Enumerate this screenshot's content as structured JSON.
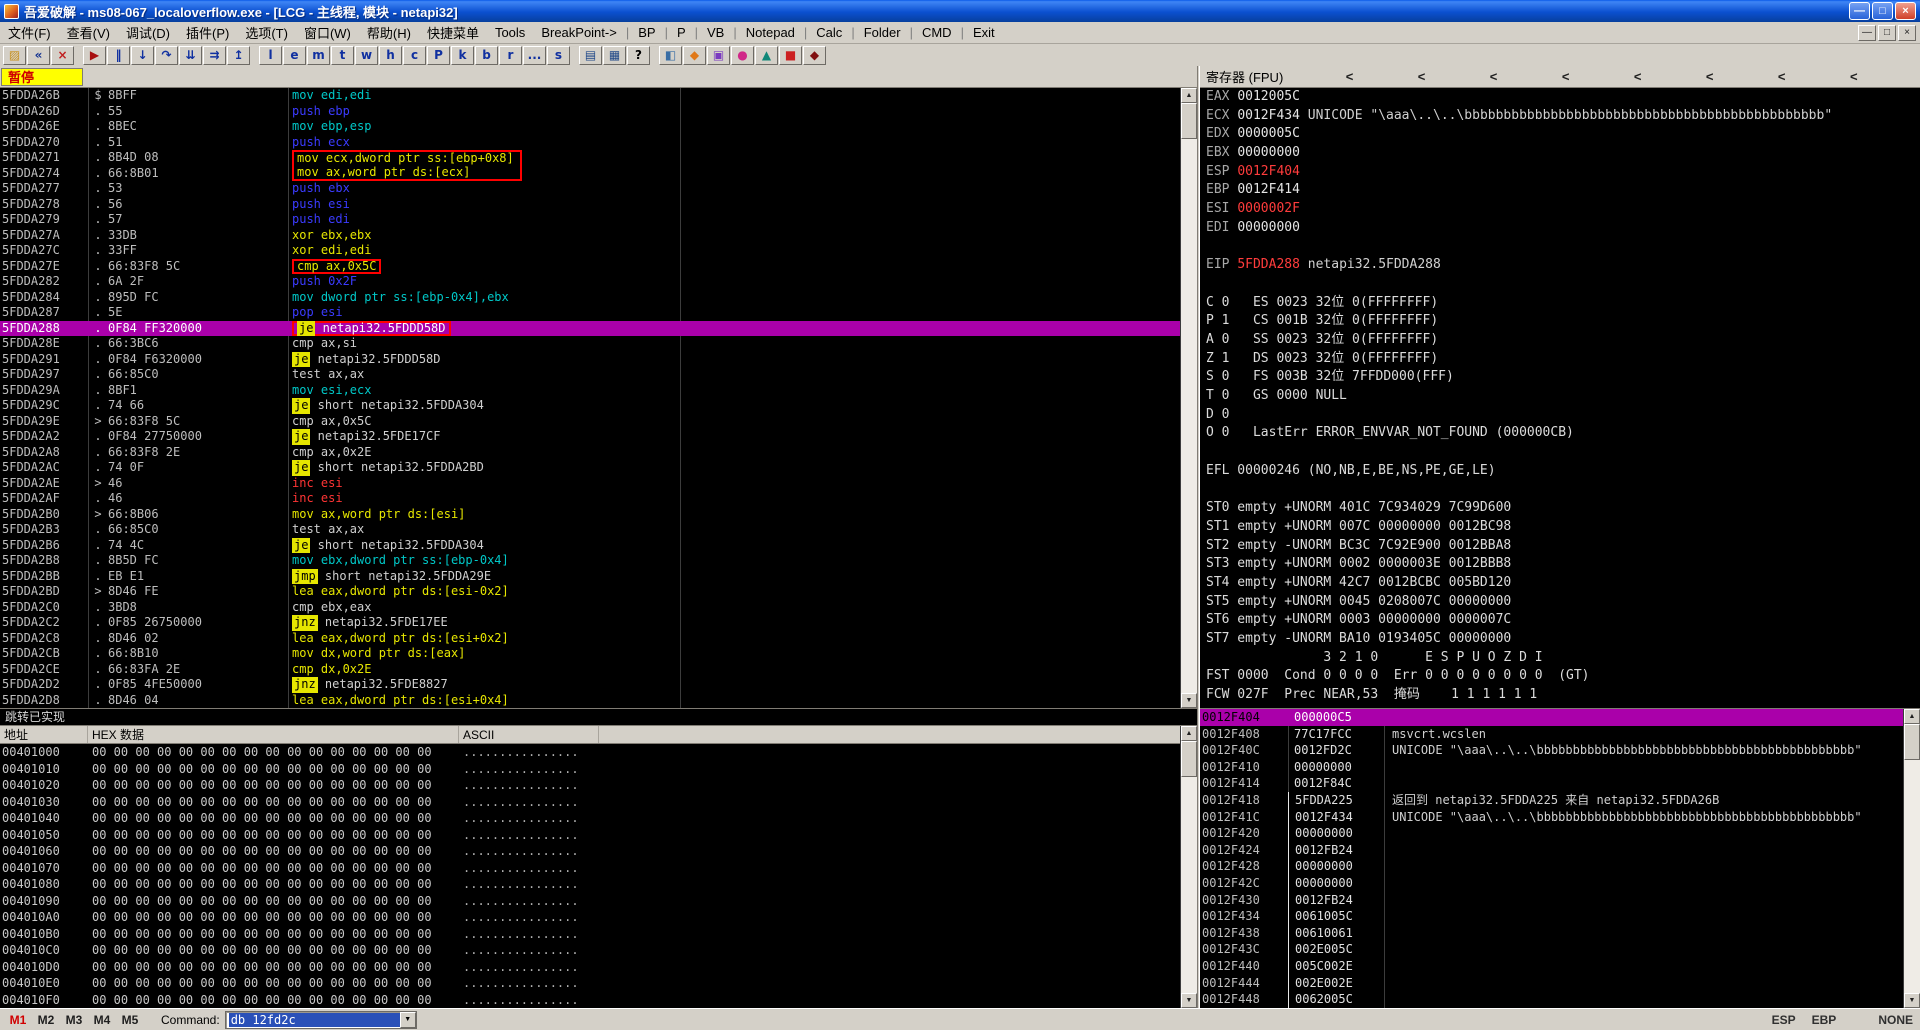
{
  "window": {
    "title": "吾爱破解 - ms08-067_localoverflow.exe - [LCG - 主线程, 模块 - netapi32]",
    "controls": {
      "minimize": "—",
      "maximize": "□",
      "close": "×"
    },
    "mdi": {
      "minimize": "—",
      "restore": "□",
      "close": "×"
    }
  },
  "icons": {
    "scroll_up": "▲",
    "scroll_down": "▼",
    "combo_down": "▼"
  },
  "menu": {
    "items": [
      "文件(F)",
      "查看(V)",
      "调试(D)",
      "插件(P)",
      "选项(T)",
      "窗口(W)",
      "帮助(H)"
    ],
    "extras": [
      "快捷菜单",
      "Tools",
      "BreakPoint->"
    ],
    "quick": [
      "BP",
      "P",
      "VB",
      "Notepad",
      "Calc",
      "Folder",
      "CMD",
      "Exit"
    ]
  },
  "toolbar": {
    "groups": [
      {
        "buttons": [
          {
            "name": "open-file-button",
            "glyph": "▨",
            "color": "#c8901c"
          },
          {
            "name": "restart-button",
            "glyph": "«",
            "color": "#103090"
          },
          {
            "name": "close-process-button",
            "glyph": "×",
            "color": "#c02020"
          }
        ]
      },
      {
        "buttons": [
          {
            "name": "run-button",
            "glyph": "▶",
            "color": "#a81010"
          },
          {
            "name": "pause-button",
            "glyph": "‖",
            "color": "#1030a0"
          },
          {
            "name": "step-into-button",
            "glyph": "↓",
            "color": "#1030a0"
          },
          {
            "name": "step-over-button",
            "glyph": "↷",
            "color": "#1030a0"
          },
          {
            "name": "trace-into-button",
            "glyph": "⇊",
            "color": "#1030a0"
          },
          {
            "name": "trace-over-button",
            "glyph": "⇉",
            "color": "#1030a0"
          },
          {
            "name": "execute-till-return-button",
            "glyph": "↥",
            "color": "#1030a0"
          }
        ]
      },
      {
        "buttons": [
          {
            "name": "log-window-button",
            "glyph": "l",
            "color": "#1030a0"
          },
          {
            "name": "executables-window-button",
            "glyph": "e",
            "color": "#1030a0"
          },
          {
            "name": "memory-map-button",
            "glyph": "m",
            "color": "#1030a0"
          },
          {
            "name": "threads-window-button",
            "glyph": "t",
            "color": "#1030a0"
          },
          {
            "name": "windows-window-button",
            "glyph": "w",
            "color": "#1030a0"
          },
          {
            "name": "handles-window-button",
            "glyph": "h",
            "color": "#1030a0"
          },
          {
            "name": "cpu-window-button",
            "glyph": "c",
            "color": "#1030a0"
          },
          {
            "name": "patches-window-button",
            "glyph": "P",
            "color": "#1030a0"
          },
          {
            "name": "call-stack-button",
            "glyph": "k",
            "color": "#1030a0"
          },
          {
            "name": "breakpoints-window-button",
            "glyph": "b",
            "color": "#1030a0"
          },
          {
            "name": "references-window-button",
            "glyph": "r",
            "color": "#1030a0"
          },
          {
            "name": "run-trace-button",
            "glyph": "...",
            "color": "#1030a0"
          },
          {
            "name": "source-window-button",
            "glyph": "s",
            "color": "#1030a0"
          }
        ]
      },
      {
        "buttons": [
          {
            "name": "log-data-button",
            "glyph": "▤",
            "color": "#204888"
          },
          {
            "name": "modules-list-button",
            "glyph": "▦",
            "color": "#204888"
          },
          {
            "name": "help-button",
            "glyph": "?",
            "color": "#000000"
          }
        ]
      },
      {
        "buttons": [
          {
            "name": "plugin-button-1",
            "glyph": "◧",
            "color": "#3a6ea5"
          },
          {
            "name": "plugin-button-2",
            "glyph": "◆",
            "color": "#e07818"
          },
          {
            "name": "plugin-button-3",
            "glyph": "▣",
            "color": "#7a3ac0"
          },
          {
            "name": "plugin-button-4",
            "glyph": "●",
            "color": "#d02888"
          },
          {
            "name": "plugin-button-5",
            "glyph": "▲",
            "color": "#108878"
          },
          {
            "name": "plugin-button-6",
            "glyph": "■",
            "color": "#cc2020"
          },
          {
            "name": "plugin-button-7",
            "glyph": "◆",
            "color": "#801010"
          }
        ]
      }
    ]
  },
  "state": {
    "label": "暂停"
  },
  "disasm": {
    "rows": [
      {
        "a": "5FDDA26B",
        "m": "$",
        "b": "8BFF",
        "t": "mov edi,edi",
        "c": "cyan"
      },
      {
        "a": "5FDDA26D",
        "m": ".",
        "b": "55",
        "t": "push ebp",
        "c": "blue"
      },
      {
        "a": "5FDDA26E",
        "m": ".",
        "b": "8BEC",
        "t": "mov ebp,esp",
        "c": "cyan"
      },
      {
        "a": "5FDDA270",
        "m": ".",
        "b": "51",
        "t": "push ecx",
        "c": "blue"
      },
      {
        "a": "5FDDA271",
        "m": ".",
        "b": "8B4D 08",
        "t": "mov ecx,dword ptr ss:[ebp+0x8]",
        "c": "yellow",
        "box": "top",
        "fixed": true
      },
      {
        "a": "5FDDA274",
        "m": ".",
        "b": "66:8B01",
        "t": "mov ax,word ptr ds:[ecx]",
        "c": "yellow",
        "box": "bottom",
        "fixed": true
      },
      {
        "a": "5FDDA277",
        "m": ".",
        "b": "53",
        "t": "push ebx",
        "c": "blue"
      },
      {
        "a": "5FDDA278",
        "m": ".",
        "b": "56",
        "t": "push esi",
        "c": "blue"
      },
      {
        "a": "5FDDA279",
        "m": ".",
        "b": "57",
        "t": "push edi",
        "c": "blue"
      },
      {
        "a": "5FDDA27A",
        "m": ".",
        "b": "33DB",
        "t": "xor ebx,ebx",
        "c": "yellow"
      },
      {
        "a": "5FDDA27C",
        "m": ".",
        "b": "33FF",
        "t": "xor edi,edi",
        "c": "yellow"
      },
      {
        "a": "5FDDA27E",
        "m": ".",
        "b": "66:83F8 5C",
        "t": "cmp ax,0x5C",
        "c": "yellow",
        "box": "single"
      },
      {
        "a": "5FDDA282",
        "m": ".",
        "b": "6A 2F",
        "t": "push 0x2F",
        "c": "blue"
      },
      {
        "a": "5FDDA284",
        "m": ".",
        "b": "895D FC",
        "t": "mov dword ptr ss:[ebp-0x4],ebx",
        "c": "cyan"
      },
      {
        "a": "5FDDA287",
        "m": ".",
        "b": "5E",
        "t": "pop esi",
        "c": "blue"
      },
      {
        "a": "5FDDA288",
        "m": ".",
        "b": "0F84 FF320000",
        "badge": "je",
        "rest": "netapi32.5FDDD58D",
        "sel": true,
        "box": "single"
      },
      {
        "a": "5FDDA28E",
        "m": ".",
        "b": "66:3BC6",
        "t": "cmp ax,si",
        "c": "white"
      },
      {
        "a": "5FDDA291",
        "m": ".",
        "b": "0F84 F6320000",
        "badge": "je",
        "rest": "netapi32.5FDDD58D"
      },
      {
        "a": "5FDDA297",
        "m": ".",
        "b": "66:85C0",
        "t": "test ax,ax",
        "c": "white"
      },
      {
        "a": "5FDDA29A",
        "m": ".",
        "b": "8BF1",
        "t": "mov esi,ecx",
        "c": "cyan"
      },
      {
        "a": "5FDDA29C",
        "m": ".",
        "b": "74 66",
        "badge": "je",
        "rest": "short netapi32.5FDDA304"
      },
      {
        "a": "5FDDA29E",
        "m": ">",
        "b": "66:83F8 5C",
        "t": "cmp ax,0x5C",
        "c": "white"
      },
      {
        "a": "5FDDA2A2",
        "m": ".",
        "b": "0F84 27750000",
        "badge": "je",
        "rest": "netapi32.5FDE17CF"
      },
      {
        "a": "5FDDA2A8",
        "m": ".",
        "b": "66:83F8 2E",
        "t": "cmp ax,0x2E",
        "c": "white"
      },
      {
        "a": "5FDDA2AC",
        "m": ".",
        "b": "74 0F",
        "badge": "je",
        "rest": "short netapi32.5FDDA2BD"
      },
      {
        "a": "5FDDA2AE",
        "m": ">",
        "b": "46",
        "t": "inc esi",
        "c": "red"
      },
      {
        "a": "5FDDA2AF",
        "m": ".",
        "b": "46",
        "t": "inc esi",
        "c": "red"
      },
      {
        "a": "5FDDA2B0",
        "m": ">",
        "b": "66:8B06",
        "t": "mov ax,word ptr ds:[esi]",
        "c": "yellow"
      },
      {
        "a": "5FDDA2B3",
        "m": ".",
        "b": "66:85C0",
        "t": "test ax,ax",
        "c": "white"
      },
      {
        "a": "5FDDA2B6",
        "m": ".",
        "b": "74 4C",
        "badge": "je",
        "rest": "short netapi32.5FDDA304"
      },
      {
        "a": "5FDDA2B8",
        "m": ".",
        "b": "8B5D FC",
        "t": "mov ebx,dword ptr ss:[ebp-0x4]",
        "c": "cyan"
      },
      {
        "a": "5FDDA2BB",
        "m": ".",
        "b": "EB E1",
        "badge": "jmp",
        "rest": "short netapi32.5FDDA29E"
      },
      {
        "a": "5FDDA2BD",
        "m": ">",
        "b": "8D46 FE",
        "t": "lea eax,dword ptr ds:[esi-0x2]",
        "c": "yellow"
      },
      {
        "a": "5FDDA2C0",
        "m": ".",
        "b": "3BD8",
        "t": "cmp ebx,eax",
        "c": "white"
      },
      {
        "a": "5FDDA2C2",
        "m": ".",
        "b": "0F85 26750000",
        "badge": "jnz",
        "rest": "netapi32.5FDE17EE"
      },
      {
        "a": "5FDDA2C8",
        "m": ".",
        "b": "8D46 02",
        "t": "lea eax,dword ptr ds:[esi+0x2]",
        "c": "yellow"
      },
      {
        "a": "5FDDA2CB",
        "m": ".",
        "b": "66:8B10",
        "t": "mov dx,word ptr ds:[eax]",
        "c": "yellow"
      },
      {
        "a": "5FDDA2CE",
        "m": ".",
        "b": "66:83FA 2E",
        "t": "cmp dx,0x2E",
        "c": "yellow"
      },
      {
        "a": "5FDDA2D2",
        "m": ".",
        "b": "0F85 4FE50000",
        "badge": "jnz",
        "rest": "netapi32.5FDE8827"
      },
      {
        "a": "5FDDA2D8",
        "m": ".",
        "b": "8D46 04",
        "t": "lea eax,dword ptr ds:[esi+0x4]",
        "c": "yellow"
      }
    ]
  },
  "info": {
    "text": "跳转已实现"
  },
  "registers": {
    "title": "寄存器 (FPU)",
    "chevrons": [
      "<",
      "<",
      "<",
      "<",
      "<",
      "<",
      "<",
      "<"
    ],
    "gpr": [
      {
        "name": "EAX",
        "value": "0012005C",
        "red": false,
        "comment": ""
      },
      {
        "name": "ECX",
        "value": "0012F434",
        "red": false,
        "comment": "UNICODE \"\\aaa\\..\\..\\bbbbbbbbbbbbbbbbbbbbbbbbbbbbbbbbbbbbbbbbbbbbbb\""
      },
      {
        "name": "EDX",
        "value": "0000005C",
        "red": false,
        "comment": ""
      },
      {
        "name": "EBX",
        "value": "00000000",
        "red": false,
        "comment": ""
      },
      {
        "name": "ESP",
        "value": "0012F404",
        "red": true,
        "comment": ""
      },
      {
        "name": "EBP",
        "value": "0012F414",
        "red": false,
        "comment": ""
      },
      {
        "name": "ESI",
        "value": "0000002F",
        "red": true,
        "comment": ""
      },
      {
        "name": "EDI",
        "value": "00000000",
        "red": false,
        "comment": ""
      }
    ],
    "eip": {
      "name": "EIP",
      "value": "5FDDA288",
      "red": true,
      "comment": "netapi32.5FDDA288"
    },
    "flags": [
      "C 0   ES 0023 32位 0(FFFFFFFF)",
      "P 1   CS 001B 32位 0(FFFFFFFF)",
      "A 0   SS 0023 32位 0(FFFFFFFF)",
      "Z 1   DS 0023 32位 0(FFFFFFFF)",
      "S 0   FS 003B 32位 7FFDD000(FFF)",
      "T 0   GS 0000 NULL",
      "D 0",
      "O 0   LastErr ERROR_ENVVAR_NOT_FOUND (000000CB)"
    ],
    "efl": "EFL 00000246 (NO,NB,E,BE,NS,PE,GE,LE)",
    "fpu": [
      "ST0 empty +UNORM 401C 7C934029 7C99D600",
      "ST1 empty +UNORM 007C 00000000 0012BC98",
      "ST2 empty -UNORM BC3C 7C92E900 0012BBA8",
      "ST3 empty +UNORM 0002 0000003E 0012BBB8",
      "ST4 empty +UNORM 42C7 0012BCBC 005BD120",
      "ST5 empty +UNORM 0045 0208007C 00000000",
      "ST6 empty +UNORM 0003 00000000 0000007C",
      "ST7 empty -UNORM BA10 0193405C 00000000"
    ],
    "fpu_bits": "               3 2 1 0      E S P U O Z D I",
    "fst": "FST 0000  Cond 0 0 0 0  Err 0 0 0 0 0 0 0 0  (GT)",
    "fcw": "FCW 027F  Prec NEAR,53  掩码    1 1 1 1 1 1"
  },
  "dump": {
    "headers": [
      "地址",
      "HEX 数据",
      "ASCII"
    ],
    "addresses": [
      "00401000",
      "00401010",
      "00401020",
      "00401030",
      "00401040",
      "00401050",
      "00401060",
      "00401070",
      "00401080",
      "00401090",
      "004010A0",
      "004010B0",
      "004010C0",
      "004010D0",
      "004010E0",
      "004010F0"
    ],
    "hex": "00 00 00 00 00 00 00 00 00 00 00 00 00 00 00 00",
    "ascii": "................"
  },
  "stack": {
    "rows": [
      {
        "addr": "0012F404",
        "value": "000000C5",
        "comment": "",
        "selected": true
      },
      {
        "addr": "0012F408",
        "value": "77C17FCC",
        "comment": "msvcrt.wcslen"
      },
      {
        "addr": "0012F40C",
        "value": "0012FD2C",
        "comment": "UNICODE \"\\aaa\\..\\..\\bbbbbbbbbbbbbbbbbbbbbbbbbbbbbbbbbbbbbbbbbbbb\""
      },
      {
        "addr": "0012F410",
        "value": "00000000",
        "comment": ""
      },
      {
        "addr": "0012F414",
        "value": "0012F84C",
        "comment": ""
      },
      {
        "addr": "0012F418",
        "value": "5FDDA225",
        "comment": "返回到 netapi32.5FDDA225 来自 netapi32.5FDDA26B",
        "frame": true
      },
      {
        "addr": "0012F41C",
        "value": "0012F434",
        "comment": "UNICODE \"\\aaa\\..\\..\\bbbbbbbbbbbbbbbbbbbbbbbbbbbbbbbbbbbbbbbbbbbb\"",
        "frame": true
      },
      {
        "addr": "0012F420",
        "value": "00000000",
        "comment": "",
        "frame": true
      },
      {
        "addr": "0012F424",
        "value": "0012FB24",
        "comment": "",
        "frame": true
      },
      {
        "addr": "0012F428",
        "value": "00000000",
        "comment": "",
        "frame": true
      },
      {
        "addr": "0012F42C",
        "value": "00000000",
        "comment": "",
        "frame": true
      },
      {
        "addr": "0012F430",
        "value": "0012FB24",
        "comment": "",
        "frame": true
      },
      {
        "addr": "0012F434",
        "value": "0061005C",
        "comment": "",
        "frame": true
      },
      {
        "addr": "0012F438",
        "value": "00610061",
        "comment": "",
        "frame": true
      },
      {
        "addr": "0012F43C",
        "value": "002E005C",
        "comment": "",
        "frame": true
      },
      {
        "addr": "0012F440",
        "value": "005C002E",
        "comment": "",
        "frame": true
      },
      {
        "addr": "0012F444",
        "value": "002E002E",
        "comment": "",
        "frame": true
      },
      {
        "addr": "0012F448",
        "value": "0062005C",
        "comment": "",
        "frame": true
      }
    ]
  },
  "command": {
    "tabs": [
      {
        "label": "M1",
        "active": true
      },
      {
        "label": "M2",
        "active": false
      },
      {
        "label": "M3",
        "active": false
      },
      {
        "label": "M4",
        "active": false
      },
      {
        "label": "M5",
        "active": false
      }
    ],
    "label": "Command:",
    "value": "db 12fd2c"
  },
  "status": {
    "items": [
      {
        "label": "ESP",
        "red": true
      },
      {
        "label": "EBP",
        "red": true
      },
      {
        "label": "NONE",
        "red": false
      }
    ]
  }
}
